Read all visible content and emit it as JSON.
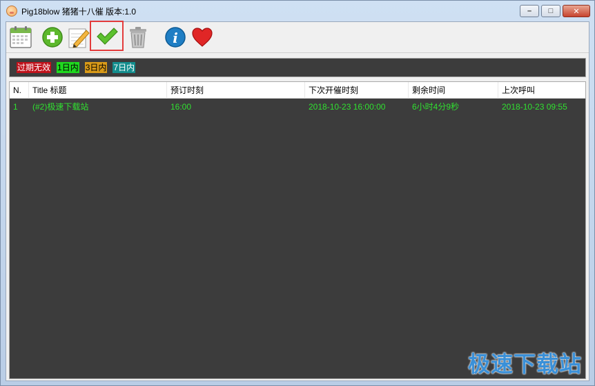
{
  "window": {
    "title": "Pig18blow 猪猪十八催 版本:1.0",
    "controls": {
      "minimize": "–",
      "maximize": "□",
      "close": "✕"
    }
  },
  "toolbar": {
    "buttons": [
      {
        "name": "calendar-icon"
      },
      {
        "name": "add-icon"
      },
      {
        "name": "edit-icon"
      },
      {
        "name": "check-icon",
        "selected": true
      },
      {
        "name": "trash-icon"
      },
      {
        "name": "info-icon"
      },
      {
        "name": "heart-icon"
      }
    ]
  },
  "legend": {
    "expired": {
      "label": "过期无效",
      "bg": "#c0121b",
      "fg": "#ffffff"
    },
    "day1": {
      "label": "1日内",
      "bg": "#1fd81f",
      "fg": "#000000"
    },
    "day3": {
      "label": "3日内",
      "bg": "#d99a18",
      "fg": "#000000"
    },
    "day7": {
      "label": "7日内",
      "bg": "#138e8e",
      "fg": "#ffffff"
    }
  },
  "table": {
    "columns": [
      "N.",
      "Title 标题",
      "预订时刻",
      "下次开催时刻",
      "剩余时间",
      "上次呼叫"
    ],
    "rows": [
      [
        "1",
        "(#2)极速下载站",
        "16:00",
        "2018-10-23 16:00:00",
        "6小时4分9秒",
        "2018-10-23 09:55"
      ]
    ],
    "row_color": "#30e030"
  },
  "watermark": "极速下载站"
}
